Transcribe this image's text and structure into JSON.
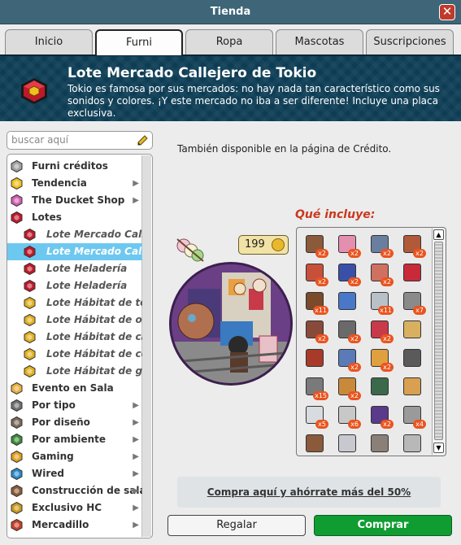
{
  "window": {
    "title": "Tienda"
  },
  "tabs": [
    {
      "label": "Inicio",
      "active": false
    },
    {
      "label": "Furni",
      "active": true
    },
    {
      "label": "Ropa",
      "active": false
    },
    {
      "label": "Mascotas",
      "active": false
    },
    {
      "label": "Suscripciones",
      "active": false
    }
  ],
  "header": {
    "title": "Lote Mercado Callejero de Tokio",
    "description": "Tokio es famosa por sus mercados: no hay nada tan característico como sus sonidos y colores. ¡Y este mercado no iba a ser diferente! Incluye una placa exclusiva.",
    "icon": "ruby-badge-icon"
  },
  "search": {
    "placeholder": "buscar aquí",
    "icon": "pencil-icon"
  },
  "categories": [
    {
      "label": "Furni créditos",
      "icon": "coins-stack-icon",
      "sub": false,
      "arrow": false
    },
    {
      "label": "Tendencia",
      "icon": "star-icon",
      "sub": false,
      "arrow": true
    },
    {
      "label": "The Ducket Shop",
      "icon": "ducket-icon",
      "sub": false,
      "arrow": true
    },
    {
      "label": "Lotes",
      "icon": "ruby-icon",
      "sub": false,
      "arrow": false
    },
    {
      "label": "Lote Mercado Callejero de Tokio",
      "icon": "ruby-badge-icon",
      "sub": true,
      "arrow": false
    },
    {
      "label": "Lote Mercado Callejero de Tokio",
      "icon": "ruby-badge-icon",
      "sub": true,
      "arrow": false,
      "selected": true
    },
    {
      "label": "Lote Heladería",
      "icon": "ruby-badge-icon",
      "sub": true,
      "arrow": false
    },
    {
      "label": "Lote Heladería",
      "icon": "ruby-badge-icon",
      "sub": true,
      "arrow": false
    },
    {
      "label": "Lote Hábitat de terriers",
      "icon": "gold-badge-icon",
      "sub": true,
      "arrow": false
    },
    {
      "label": "Lote Hábitat de osito polar",
      "icon": "gold-badge-icon",
      "sub": true,
      "arrow": false
    },
    {
      "label": "Lote Hábitat de cachorro",
      "icon": "gold-badge-icon",
      "sub": true,
      "arrow": false
    },
    {
      "label": "Lote Hábitat de cerditos",
      "icon": "gold-badge-icon",
      "sub": true,
      "arrow": false
    },
    {
      "label": "Lote Hábitat de gatitos",
      "icon": "gold-badge-icon",
      "sub": true,
      "arrow": false
    },
    {
      "label": "Evento en Sala",
      "icon": "event-cube-icon",
      "sub": false,
      "arrow": false
    },
    {
      "label": "Por tipo",
      "icon": "chair-icon",
      "sub": false,
      "arrow": true
    },
    {
      "label": "Por diseño",
      "icon": "column-icon",
      "sub": false,
      "arrow": true
    },
    {
      "label": "Por ambiente",
      "icon": "plant-icon",
      "sub": false,
      "arrow": true
    },
    {
      "label": "Gaming",
      "icon": "trophy-icon",
      "sub": false,
      "arrow": true
    },
    {
      "label": "Wired",
      "icon": "wired-icon",
      "sub": false,
      "arrow": true
    },
    {
      "label": "Construcción de salas",
      "icon": "pickaxe-icon",
      "sub": false,
      "arrow": true
    },
    {
      "label": "Exclusivo HC",
      "icon": "hc-icon",
      "sub": false,
      "arrow": true
    },
    {
      "label": "Mercadillo",
      "icon": "market-icon",
      "sub": false,
      "arrow": true
    }
  ],
  "main": {
    "availability": "También disponible en la página de Crédito.",
    "price": "199",
    "price_icon": "credit-coin-icon",
    "includes_title": "Qué incluye:",
    "items": [
      {
        "icon": "mushroom-table-icon",
        "qty": "x2",
        "color": "#8a5a3a"
      },
      {
        "icon": "blossom-tree-icon",
        "qty": "x2",
        "color": "#e58fb0"
      },
      {
        "icon": "shop-sign-icon",
        "qty": "x2",
        "color": "#6a7fa0"
      },
      {
        "icon": "robot-icon",
        "qty": "x2",
        "color": "#b05a3a"
      },
      {
        "icon": "lantern-string-icon",
        "qty": "x2",
        "color": "#c8503a"
      },
      {
        "icon": "scooter-icon",
        "qty": "x2",
        "color": "#3a50a8"
      },
      {
        "icon": "steam-pot-icon",
        "qty": "x2",
        "color": "#d07060"
      },
      {
        "icon": "vending-machine-icon",
        "qty": "",
        "color": "#c82a3a"
      },
      {
        "icon": "wooden-screen-icon",
        "qty": "x11",
        "color": "#7a4a2a"
      },
      {
        "icon": "blue-fence-icon",
        "qty": "",
        "color": "#4a78c8"
      },
      {
        "icon": "fridge-icon",
        "qty": "x11",
        "color": "#b8c0c8"
      },
      {
        "icon": "pipe-icon",
        "qty": "x7",
        "color": "#8a8a8a"
      },
      {
        "icon": "stall-icon",
        "qty": "x2",
        "color": "#8a4a3a"
      },
      {
        "icon": "power-pole-icon",
        "qty": "x2",
        "color": "#6a6a6a"
      },
      {
        "icon": "food-counter-icon",
        "qty": "x2",
        "color": "#c83a4a"
      },
      {
        "icon": "ramen-stand-icon",
        "qty": "",
        "color": "#d8b060"
      },
      {
        "icon": "basket-icon",
        "qty": "",
        "color": "#a83a2a"
      },
      {
        "icon": "building-icon",
        "qty": "x2",
        "color": "#5a7ab8"
      },
      {
        "icon": "poster-icon",
        "qty": "x2",
        "color": "#e0a040"
      },
      {
        "icon": "street-lamp-icon",
        "qty": "",
        "color": "#5a5a5a"
      },
      {
        "icon": "grate-icon",
        "qty": "x15",
        "color": "#7a7a7a"
      },
      {
        "icon": "door-icon",
        "qty": "x2",
        "color": "#c88a3a"
      },
      {
        "icon": "dragon-statue-icon",
        "qty": "",
        "color": "#3a6a4a"
      },
      {
        "icon": "floor-rug-icon",
        "qty": "",
        "color": "#d8a050"
      },
      {
        "icon": "cabinet-icon",
        "qty": "x5",
        "color": "#d8dce0"
      },
      {
        "icon": "doorway-icon",
        "qty": "x6",
        "color": "#c8c8c8"
      },
      {
        "icon": "arcade-icon",
        "qty": "x2",
        "color": "#5a3a8a"
      },
      {
        "icon": "railing-icon",
        "qty": "x4",
        "color": "#9a9a9a"
      },
      {
        "icon": "crate-icon",
        "qty": "",
        "color": "#8a5a3a"
      },
      {
        "icon": "wall-icon",
        "qty": "",
        "color": "#c8c8d0"
      },
      {
        "icon": "floor-tile-icon",
        "qty": "",
        "color": "#8a8078"
      },
      {
        "icon": "gate-icon",
        "qty": "",
        "color": "#b8b8b8"
      }
    ],
    "promo": "Compra aquí y ahórrate más del 50%",
    "gift_label": "Regalar",
    "buy_label": "Comprar"
  },
  "colors": {
    "accent": "#0f9d32",
    "header_bg": "#0d3d55",
    "selected": "#6dc8f0",
    "qty_badge": "#e9541f"
  }
}
